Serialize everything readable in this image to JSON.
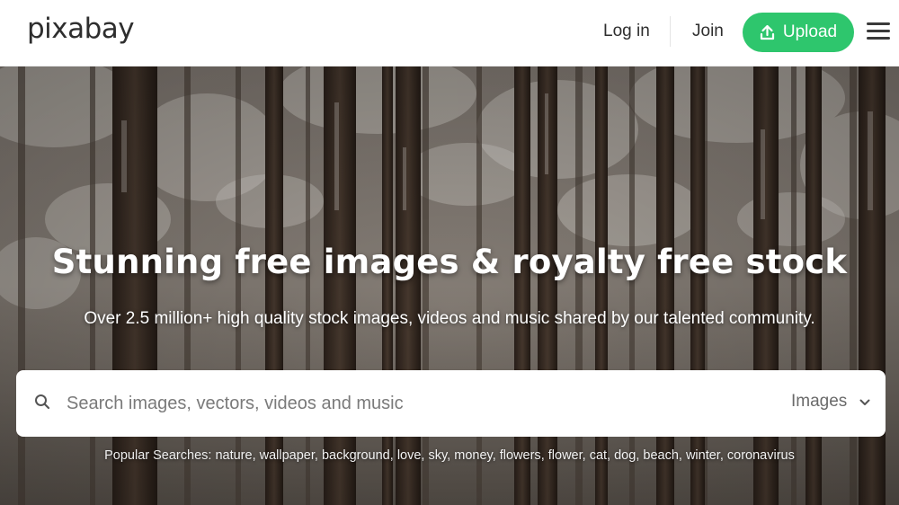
{
  "header": {
    "logo": "pixabay",
    "login_label": "Log in",
    "join_label": "Join",
    "upload_label": "Upload",
    "accent_color": "#2ec66d"
  },
  "hero": {
    "title": "Stunning free images & royalty free stock",
    "subtitle": "Over 2.5 million+ high quality stock images, videos and music shared by our talented community.",
    "background": "snowy forest photo"
  },
  "search": {
    "placeholder": "Search images, vectors, videos and music",
    "value": "",
    "type_selected": "Images"
  },
  "popular": {
    "label": "Popular Searches:",
    "terms": [
      "nature",
      "wallpaper",
      "background",
      "love",
      "sky",
      "money",
      "flowers",
      "flower",
      "cat",
      "dog",
      "beach",
      "winter",
      "coronavirus"
    ]
  },
  "icons": {
    "upload": "upload-arrow-icon",
    "menu": "hamburger-menu-icon",
    "search": "search-icon",
    "dropdown": "chevron-down-icon"
  }
}
